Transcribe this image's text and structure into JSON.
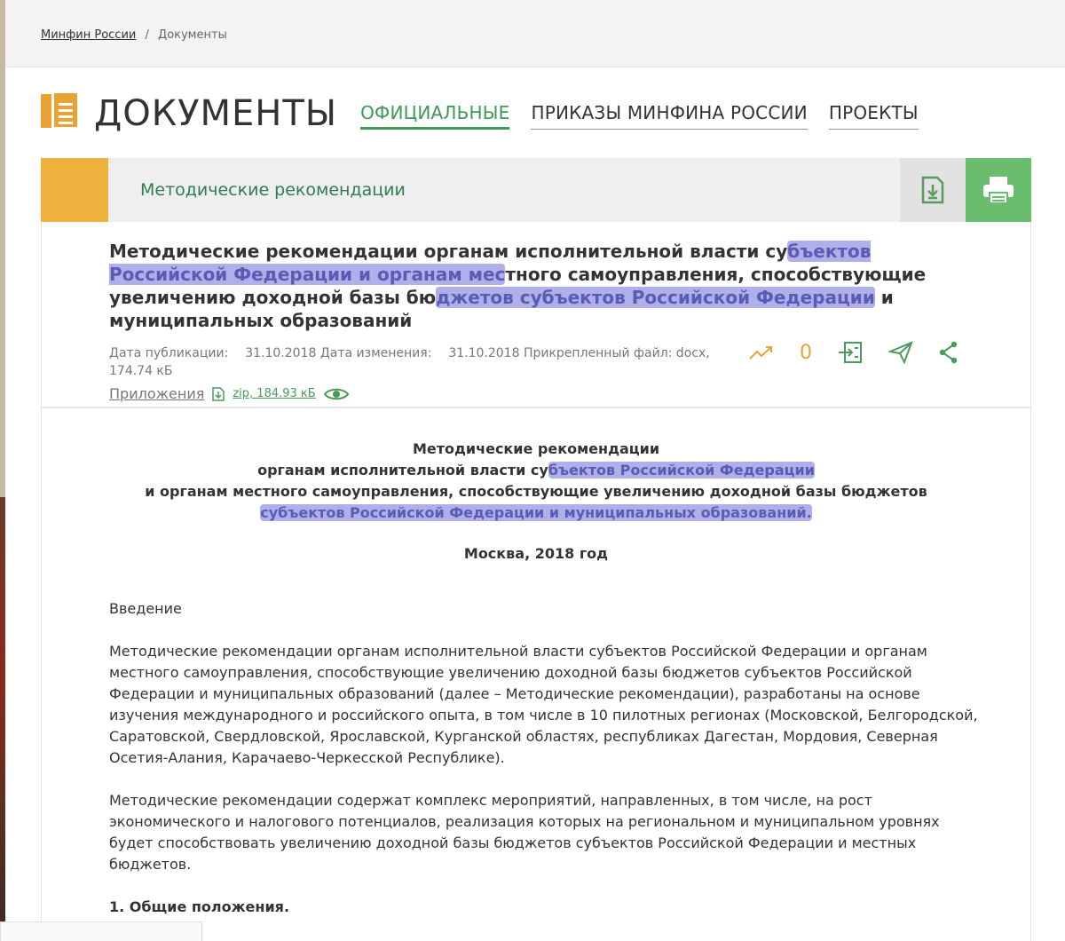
{
  "breadcrumb": {
    "home": "Минфин России",
    "separator": "/",
    "current": "Документы"
  },
  "header": {
    "title": "ДОКУМЕНТЫ",
    "tabs": [
      {
        "label": "ОФИЦИАЛЬНЫЕ",
        "active": true
      },
      {
        "label": "ПРИКАЗЫ МИНФИНА РОССИИ",
        "active": false
      },
      {
        "label": "ПРОЕКТЫ",
        "active": false
      }
    ]
  },
  "section_bar": {
    "title": "Методические рекомендации",
    "download_icon": "download-doc-icon",
    "print_icon": "printer-icon"
  },
  "document": {
    "title_parts": [
      "Методические рекомендации органам исполнительной власти су",
      "бъектов Российской Федерации и органам мес",
      "тного самоуправления, способствующие увеличению доходной базы бю",
      "джетов субъектов Российской Федерации",
      " и муниципальных образований"
    ],
    "meta": {
      "published_label": "Дата публикации:",
      "published": "31.10.2018",
      "changed_label": "Дата изменения:",
      "changed": "31.10.2018",
      "file_label": "Прикрепленный файл: docx,",
      "file_size": "174.74 кБ"
    },
    "counter": "0",
    "attachments_label": "Приложения",
    "zip_label": "zip, 184.93 кБ"
  },
  "body": {
    "heading_lines": [
      "Методические рекомендации",
      "органам исполнительной власти су",
      "бъектов Российской Федерации",
      "и органам местного самоуправления, способствующие увеличению доходной базы бюджетов",
      "субъектов Российской Федерации и муниципальных образований."
    ],
    "city_year": "Москва, 2018 год",
    "intro_heading": "Введение",
    "paragraph1": "Методические рекомендации органам исполнительной власти субъектов Российской Федерации и органам местного самоуправления, способствующие увеличению доходной базы бюджетов субъектов Российской Федерации и муниципальных образований (далее – Методические рекомендации), разработаны на основе изучения международного и российского опыта, в том числе в 10 пилотных регионах (Московской, Белгородской, Саратовской, Свердловской, Ярославской, Курганской областях, республиках Дагестан, Мордовия, Северная Осетия-Алания, Карачаево-Черкесской Республике).",
    "paragraph2": "Методические рекомендации содержат комплекс мероприятий, направленных, в том числе, на рост экономического и налогового потенциалов, реализация которых на региональном и муниципальном уровнях будет способствовать увеличению доходной базы бюджетов субъектов Российской Федерации и местных бюджетов.",
    "section1": "1. Общие положения."
  },
  "colors": {
    "accent_green": "#3d9a54",
    "accent_orange": "#f0b23e",
    "print_green": "#6bbd6e",
    "highlight": "#6e6ed7"
  }
}
